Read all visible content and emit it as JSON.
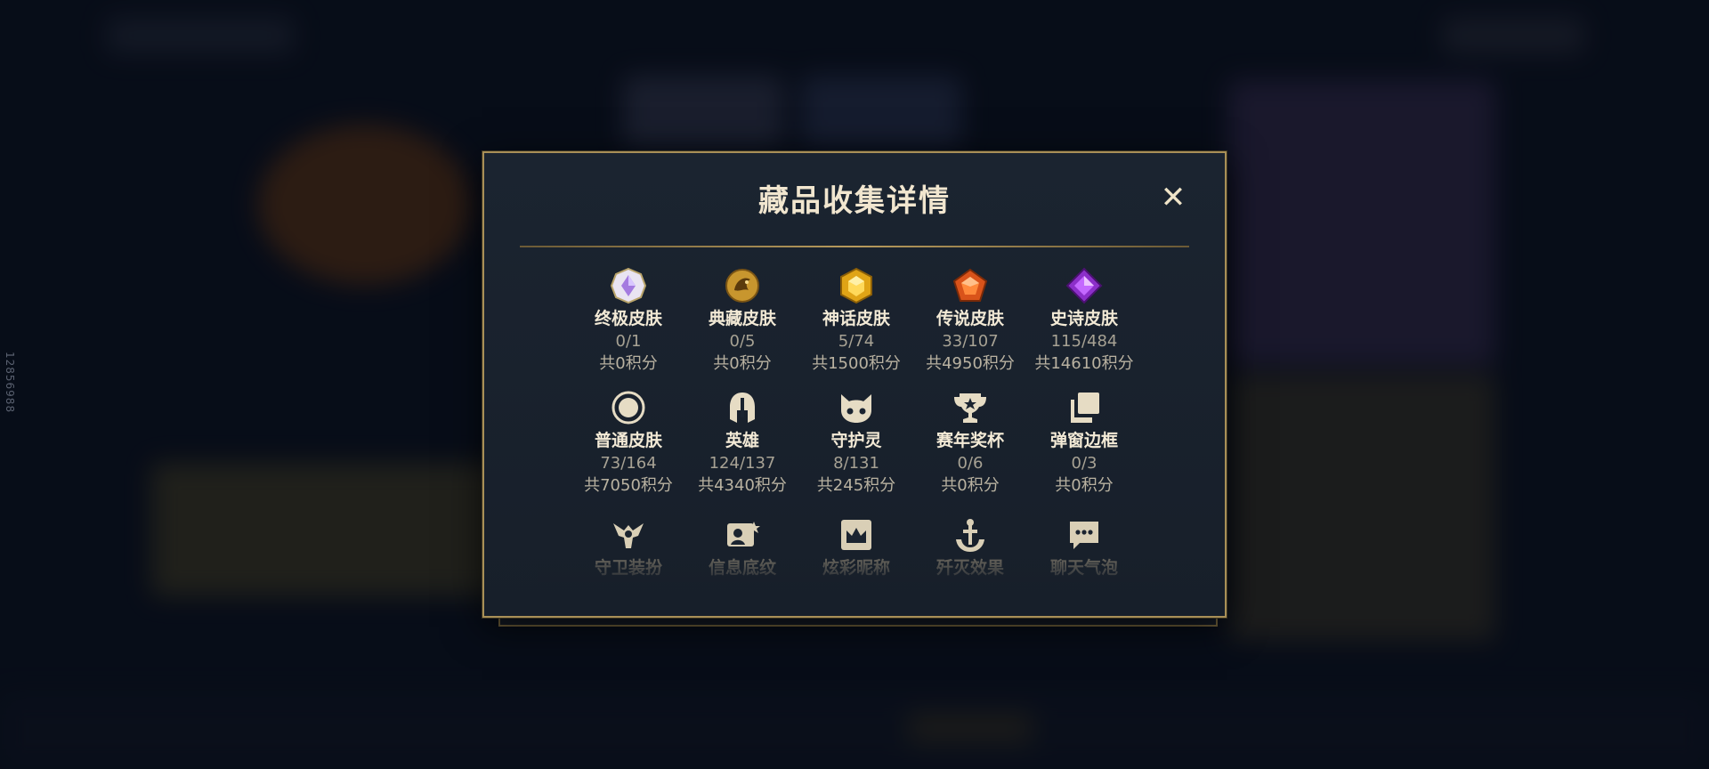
{
  "side_id": "12856988",
  "modal": {
    "title": "藏品收集详情",
    "close_label": "✕"
  },
  "collections": [
    {
      "name": "终极皮肤",
      "count": "0/1",
      "points": "共0积分",
      "icon": "ultimate-skin-icon"
    },
    {
      "name": "典藏皮肤",
      "count": "0/5",
      "points": "共0积分",
      "icon": "prestige-skin-icon"
    },
    {
      "name": "神话皮肤",
      "count": "5/74",
      "points": "共1500积分",
      "icon": "mythic-skin-icon"
    },
    {
      "name": "传说皮肤",
      "count": "33/107",
      "points": "共4950积分",
      "icon": "legendary-skin-icon"
    },
    {
      "name": "史诗皮肤",
      "count": "115/484",
      "points": "共14610积分",
      "icon": "epic-skin-icon"
    },
    {
      "name": "普通皮肤",
      "count": "73/164",
      "points": "共7050积分",
      "icon": "normal-skin-icon"
    },
    {
      "name": "英雄",
      "count": "124/137",
      "points": "共4340积分",
      "icon": "champion-helmet-icon"
    },
    {
      "name": "守护灵",
      "count": "8/131",
      "points": "共245积分",
      "icon": "guardian-icon"
    },
    {
      "name": "赛年奖杯",
      "count": "0/6",
      "points": "共0积分",
      "icon": "trophy-icon"
    },
    {
      "name": "弹窗边框",
      "count": "0/3",
      "points": "共0积分",
      "icon": "frame-icon"
    }
  ],
  "collections_more": [
    {
      "name": "守卫装扮",
      "icon": "ward-skin-icon"
    },
    {
      "name": "信息底纹",
      "icon": "banner-icon"
    },
    {
      "name": "炫彩昵称",
      "icon": "nickname-icon"
    },
    {
      "name": "歼灭效果",
      "icon": "kill-effect-icon"
    },
    {
      "name": "聊天气泡",
      "icon": "chat-bubble-icon"
    }
  ],
  "colors": {
    "accent_gold": "#a88f57",
    "title": "#f1e6cf",
    "panel": "#1b2430"
  }
}
